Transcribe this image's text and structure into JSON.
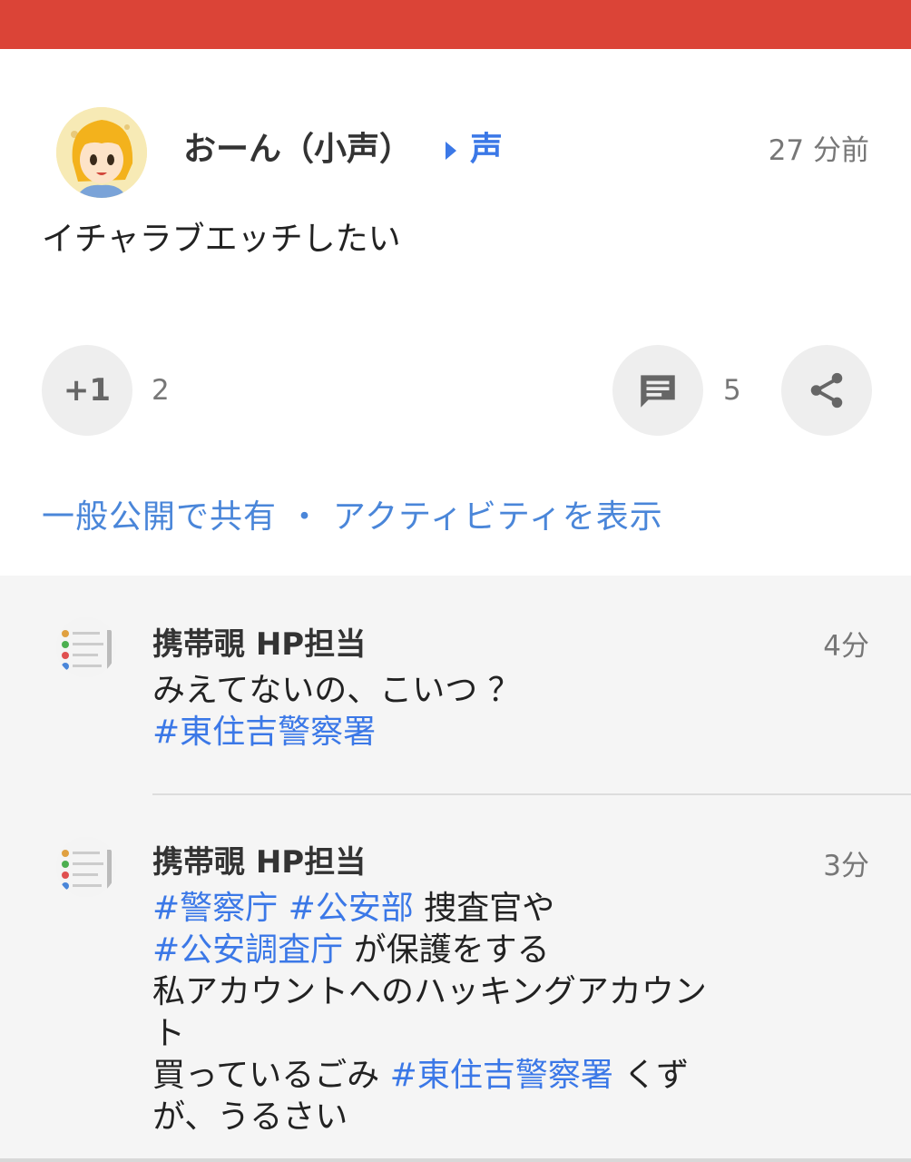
{
  "post": {
    "author": "おーん（小声）",
    "circle": "声",
    "timestamp": "27 分前",
    "body": "イチャラブエッチしたい",
    "plus_label": "+1",
    "plus_count": "2",
    "comment_count": "5",
    "activity_link": "一般公開で共有 ・ アクティビティを表示"
  },
  "comments": [
    {
      "author": "携帯覗 HP担当",
      "time": "4分",
      "line1": "みえてないの、こいつ ？",
      "line2_tag": "#東住吉警察署"
    },
    {
      "author": "携帯覗 HP担当",
      "time": "3分",
      "tag1": "#警察庁",
      "tag2": "#公安部",
      "text1": " 捜査官や",
      "tag3": "#公安調査庁",
      "text2": " が保護をする",
      "line3": "私アカウントへのハッキングアカウン",
      "line4": "ト",
      "text5a": "買っているごみ ",
      "tag4": "#東住吉警察署",
      "text5b": " くず",
      "line6": "が、うるさい"
    }
  ],
  "icons": {
    "topbar": "red-header-bar",
    "comment": "comment-icon",
    "share": "share-icon",
    "circle_arrow": "arrow-right-icon"
  },
  "colors": {
    "header": "#db4437",
    "link": "#3b78e7",
    "comments_bg": "#f5f5f5"
  }
}
